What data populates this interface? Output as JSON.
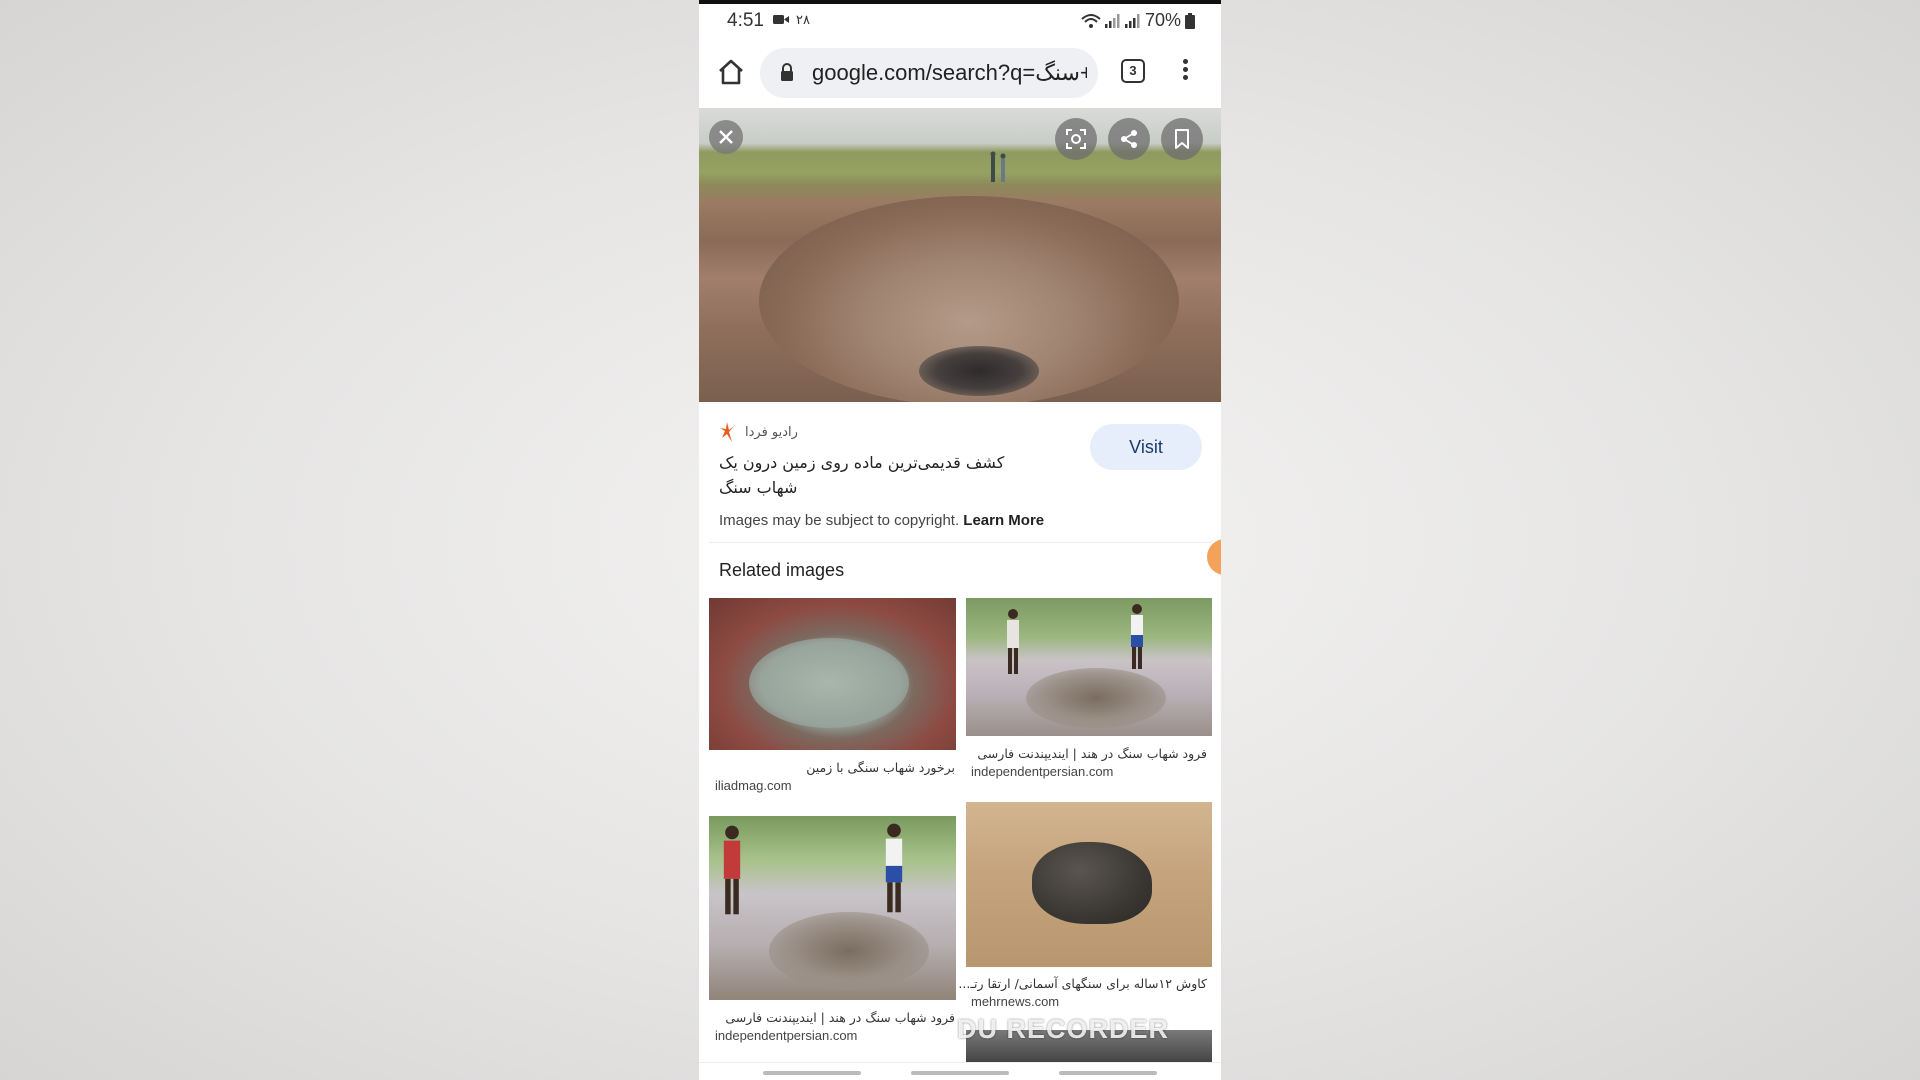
{
  "status_bar": {
    "time": "4:51",
    "date": "۲۸",
    "battery": "70%"
  },
  "browser": {
    "url": "google.com/search?q=شهاب+سنگ",
    "tab_count": "3"
  },
  "result": {
    "source_name": "رادیو فردا",
    "title": "کشف قدیمی‌ترین ماده روی زمین درون یک شهاب سنگ",
    "visit_label": "Visit",
    "copyright_text": "Images may be subject to copyright.",
    "learn_more": "Learn More"
  },
  "related": {
    "heading": "Related images",
    "items": [
      {
        "title": "برخورد شهاب سنگی با زمین",
        "domain": "iliadmag.com"
      },
      {
        "title": "فرود شهاب سنگ در هند | ایندیپندنت فارسی",
        "domain": "independentpersian.com"
      },
      {
        "title": "فرود شهاب سنگ در هند | ایندیپندنت فارسی",
        "domain": "independentpersian.com"
      },
      {
        "title": "کاوش ۱۲ساله برای سنگهای آسمانی/ ارتقا رتـ...",
        "domain": "mehrnews.com"
      }
    ]
  },
  "overlay": {
    "watermark": "DU RECORDER"
  },
  "colors": {
    "visit_bg": "#e6eefb",
    "accent_orange": "#f4a259"
  }
}
